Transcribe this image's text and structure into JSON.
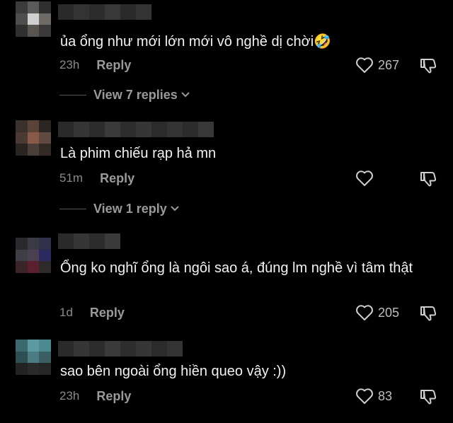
{
  "comments": [
    {
      "text": "ủa ổng như mới lớn mới vô nghề dị chời🤣",
      "time": "23h",
      "reply_label": "Reply",
      "likes": "267",
      "view_replies": "View 7 replies"
    },
    {
      "text": "Là phim chiếu rạp hả mn",
      "time": "51m",
      "reply_label": "Reply",
      "likes": "",
      "view_replies": "View 1 reply"
    },
    {
      "text": "Ổng ko nghĩ ổng là ngôi sao á, đúng lm nghề vì tâm thật",
      "time": "1d",
      "reply_label": "Reply",
      "likes": "205",
      "view_replies": ""
    },
    {
      "text": "sao bên ngoài ổng hiền queo vậy :))",
      "time": "23h",
      "reply_label": "Reply",
      "likes": "83",
      "view_replies": ""
    }
  ],
  "icons": {
    "like": "heart-outline-icon",
    "dislike": "thumbs-down-outline-icon",
    "expand": "chevron-down-icon"
  },
  "colors": {
    "background": "#000000",
    "text": "#f2f2f2",
    "muted": "#8a8a8a"
  }
}
